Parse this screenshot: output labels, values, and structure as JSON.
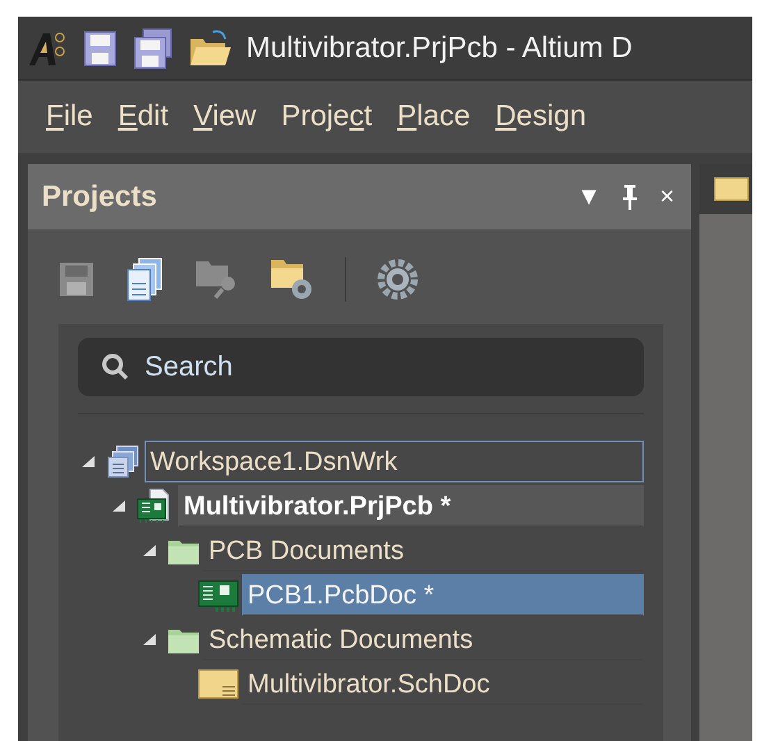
{
  "window": {
    "title": "Multivibrator.PrjPcb - Altium D"
  },
  "menu": [
    {
      "key": "F",
      "rest": "ile"
    },
    {
      "key": "E",
      "rest": "dit"
    },
    {
      "key": "V",
      "rest": "iew"
    },
    {
      "lead": "Proje",
      "key": "c",
      "rest": "t"
    },
    {
      "key": "P",
      "rest": "lace"
    },
    {
      "key": "D",
      "rest": "esign"
    }
  ],
  "panel": {
    "title": "Projects",
    "menu_glyph": "▼",
    "close_glyph": "×",
    "search": {
      "placeholder": "Search"
    },
    "tree": [
      {
        "label": "Workspace1.DsnWrk",
        "kind": "workspace",
        "expanded": true,
        "selected": false,
        "focused": true,
        "active": false,
        "children": [
          {
            "label": "Multivibrator.PrjPcb *",
            "kind": "project",
            "expanded": true,
            "selected": false,
            "focused": false,
            "active": true,
            "children": [
              {
                "label": "PCB Documents",
                "kind": "folder",
                "expanded": true,
                "selected": false,
                "focused": false,
                "active": false,
                "children": [
                  {
                    "label": "PCB1.PcbDoc *",
                    "kind": "pcb",
                    "selected": true,
                    "focused": false,
                    "active": false
                  }
                ]
              },
              {
                "label": "Schematic Documents",
                "kind": "folder",
                "expanded": true,
                "selected": false,
                "focused": false,
                "active": false,
                "children": [
                  {
                    "label": "Multivibrator.SchDoc",
                    "kind": "schematic",
                    "selected": false,
                    "focused": false,
                    "active": false
                  }
                ]
              }
            ]
          }
        ]
      }
    ]
  }
}
